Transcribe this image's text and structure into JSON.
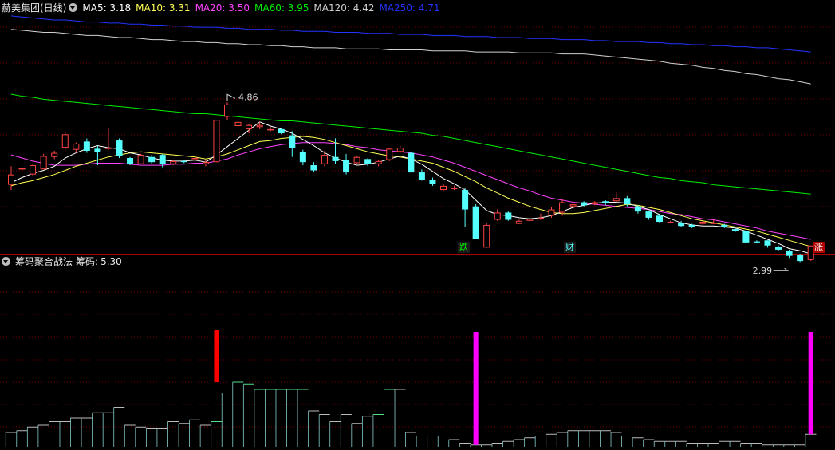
{
  "header": {
    "stock": "赫美集团(日线)",
    "ma": [
      {
        "label": "MA5:",
        "value": "3.18",
        "color": "#ffffff"
      },
      {
        "label": "MA10:",
        "value": "3.31",
        "color": "#ffff55"
      },
      {
        "label": "MA20:",
        "value": "3.50",
        "color": "#ff44ff"
      },
      {
        "label": "MA60:",
        "value": "3.95",
        "color": "#00ee00"
      },
      {
        "label": "MA120:",
        "value": "4.42",
        "color": "#d0d0d0"
      },
      {
        "label": "MA250:",
        "value": "4.71",
        "color": "#2233ff"
      }
    ]
  },
  "indicator": {
    "title": "筹码聚合战法",
    "label": "筹码:",
    "value": "5.30"
  },
  "tags": {
    "high": "4.86",
    "low": "2.99",
    "die": "跌",
    "cai": "财",
    "zhang": "涨"
  },
  "colors": {
    "up": "#ff4444",
    "down": "#54ffff",
    "grid": "#7a0000",
    "divider": "#aa0000",
    "magenta": "#ff00ff",
    "red": "#ff0000"
  },
  "chart_data": {
    "type": "candlestick",
    "price_range": [
      2.9,
      5.1
    ],
    "candles": [
      [
        3.43,
        3.53,
        3.38,
        3.61
      ],
      [
        3.58,
        3.59,
        3.55,
        3.64
      ],
      [
        3.53,
        3.62,
        3.51,
        3.63
      ],
      [
        3.58,
        3.71,
        3.58,
        3.73
      ],
      [
        3.7,
        3.74,
        3.68,
        3.76
      ],
      [
        3.79,
        3.92,
        3.77,
        3.94
      ],
      [
        3.77,
        3.83,
        3.74,
        3.84
      ],
      [
        3.85,
        3.76,
        3.74,
        3.88
      ],
      [
        3.78,
        3.75,
        3.62,
        3.81
      ],
      [
        3.79,
        3.79,
        3.77,
        3.98
      ],
      [
        3.86,
        3.71,
        3.69,
        3.88
      ],
      [
        3.69,
        3.63,
        3.62,
        3.7
      ],
      [
        3.63,
        3.72,
        3.63,
        3.73
      ],
      [
        3.7,
        3.65,
        3.63,
        3.72
      ],
      [
        3.72,
        3.63,
        3.6,
        3.73
      ],
      [
        3.63,
        3.66,
        3.62,
        3.67
      ],
      [
        3.66,
        3.65,
        3.64,
        3.67
      ],
      [
        3.68,
        3.69,
        3.65,
        3.7
      ],
      [
        3.63,
        3.65,
        3.61,
        3.67
      ],
      [
        3.65,
        4.06,
        3.65,
        4.06
      ],
      [
        4.09,
        4.21,
        4.06,
        4.23
      ],
      [
        4.0,
        4.04,
        3.98,
        4.05
      ],
      [
        3.97,
        4.01,
        3.93,
        4.02
      ],
      [
        3.99,
        4.01,
        3.97,
        4.04
      ],
      [
        3.97,
        3.97,
        3.95,
        3.99
      ],
      [
        3.97,
        3.93,
        3.92,
        3.98
      ],
      [
        3.91,
        3.79,
        3.7,
        3.95
      ],
      [
        3.75,
        3.65,
        3.62,
        3.77
      ],
      [
        3.62,
        3.57,
        3.55,
        3.65
      ],
      [
        3.63,
        3.72,
        3.61,
        3.76
      ],
      [
        3.7,
        3.66,
        3.63,
        3.88
      ],
      [
        3.67,
        3.55,
        3.53,
        3.73
      ],
      [
        3.64,
        3.7,
        3.63,
        3.71
      ],
      [
        3.68,
        3.63,
        3.61,
        3.69
      ],
      [
        3.63,
        3.66,
        3.61,
        3.67
      ],
      [
        3.67,
        3.78,
        3.66,
        3.79
      ],
      [
        3.75,
        3.79,
        3.74,
        3.81
      ],
      [
        3.74,
        3.55,
        3.55,
        3.75
      ],
      [
        3.55,
        3.48,
        3.47,
        3.58
      ],
      [
        3.48,
        3.44,
        3.42,
        3.5
      ],
      [
        3.38,
        3.42,
        3.37,
        3.44
      ],
      [
        3.4,
        3.4,
        3.38,
        3.42
      ],
      [
        3.38,
        3.19,
        3.02,
        3.4
      ],
      [
        3.22,
        2.9,
        2.9,
        3.24
      ],
      [
        2.82,
        3.04,
        2.82,
        3.06
      ],
      [
        3.09,
        3.16,
        3.08,
        3.19
      ],
      [
        3.16,
        3.09,
        3.08,
        3.17
      ],
      [
        3.05,
        3.08,
        3.05,
        3.09
      ],
      [
        3.08,
        3.1,
        3.07,
        3.12
      ],
      [
        3.1,
        3.11,
        3.09,
        3.15
      ],
      [
        3.13,
        3.19,
        3.11,
        3.21
      ],
      [
        3.16,
        3.26,
        3.13,
        3.29
      ],
      [
        3.22,
        3.24,
        3.19,
        3.27
      ],
      [
        3.26,
        3.23,
        3.22,
        3.27
      ],
      [
        3.24,
        3.26,
        3.23,
        3.27
      ],
      [
        3.27,
        3.25,
        3.23,
        3.28
      ],
      [
        3.27,
        3.3,
        3.25,
        3.36
      ],
      [
        3.3,
        3.24,
        3.22,
        3.32
      ],
      [
        3.22,
        3.17,
        3.15,
        3.23
      ],
      [
        3.17,
        3.11,
        3.09,
        3.18
      ],
      [
        3.13,
        3.07,
        3.06,
        3.15
      ],
      [
        3.07,
        3.07,
        3.06,
        3.08
      ],
      [
        3.06,
        3.03,
        3.02,
        3.08
      ],
      [
        3.04,
        3.02,
        3.01,
        3.05
      ],
      [
        3.05,
        3.07,
        3.02,
        3.08
      ],
      [
        3.06,
        3.06,
        3.05,
        3.09
      ],
      [
        3.04,
        3.02,
        3.01,
        3.05
      ],
      [
        3.0,
        2.98,
        2.97,
        3.01
      ],
      [
        2.98,
        2.87,
        2.85,
        2.99
      ],
      [
        2.88,
        2.87,
        2.86,
        2.89
      ],
      [
        2.89,
        2.84,
        2.82,
        2.89
      ],
      [
        2.83,
        2.8,
        2.79,
        2.84
      ],
      [
        2.79,
        2.74,
        2.72,
        2.8
      ],
      [
        2.75,
        2.69,
        2.68,
        2.76
      ],
      [
        2.7,
        2.84,
        2.69,
        2.84
      ]
    ],
    "ma5": [
      3.45,
      3.5,
      3.54,
      3.57,
      3.61,
      3.69,
      3.74,
      3.78,
      3.81,
      3.79,
      3.78,
      3.74,
      3.72,
      3.69,
      3.67,
      3.66,
      3.66,
      3.67,
      3.65,
      3.72,
      3.8,
      3.88,
      3.96,
      4.04,
      4.0,
      3.97,
      3.93,
      3.87,
      3.81,
      3.74,
      3.69,
      3.65,
      3.62,
      3.63,
      3.65,
      3.68,
      3.71,
      3.68,
      3.63,
      3.56,
      3.49,
      3.44,
      3.38,
      3.28,
      3.18,
      3.14,
      3.13,
      3.11,
      3.1,
      3.11,
      3.13,
      3.17,
      3.21,
      3.23,
      3.25,
      3.26,
      3.26,
      3.25,
      3.22,
      3.19,
      3.14,
      3.1,
      3.06,
      3.04,
      3.03,
      3.03,
      3.02,
      3.01,
      2.98,
      2.94,
      2.9,
      2.86,
      2.81,
      2.79,
      2.76
    ],
    "ma10": [
      3.42,
      3.45,
      3.47,
      3.5,
      3.53,
      3.57,
      3.61,
      3.64,
      3.67,
      3.7,
      3.72,
      3.74,
      3.75,
      3.74,
      3.73,
      3.72,
      3.71,
      3.7,
      3.68,
      3.7,
      3.73,
      3.77,
      3.81,
      3.85,
      3.86,
      3.88,
      3.89,
      3.9,
      3.89,
      3.87,
      3.84,
      3.81,
      3.78,
      3.75,
      3.73,
      3.71,
      3.7,
      3.68,
      3.66,
      3.64,
      3.6,
      3.56,
      3.51,
      3.46,
      3.4,
      3.35,
      3.3,
      3.26,
      3.22,
      3.19,
      3.16,
      3.15,
      3.15,
      3.16,
      3.18,
      3.2,
      3.22,
      3.24,
      3.23,
      3.21,
      3.19,
      3.16,
      3.13,
      3.1,
      3.08,
      3.06,
      3.04,
      3.02,
      3.0,
      2.98,
      2.95,
      2.92,
      2.89,
      2.86,
      2.83
    ],
    "ma20": [
      3.72,
      3.69,
      3.66,
      3.64,
      3.62,
      3.62,
      3.62,
      3.63,
      3.64,
      3.64,
      3.64,
      3.63,
      3.62,
      3.62,
      3.62,
      3.63,
      3.63,
      3.64,
      3.64,
      3.66,
      3.68,
      3.72,
      3.75,
      3.78,
      3.8,
      3.82,
      3.83,
      3.84,
      3.84,
      3.84,
      3.83,
      3.82,
      3.8,
      3.79,
      3.77,
      3.76,
      3.75,
      3.74,
      3.72,
      3.7,
      3.67,
      3.64,
      3.6,
      3.56,
      3.52,
      3.48,
      3.44,
      3.4,
      3.37,
      3.33,
      3.3,
      3.28,
      3.26,
      3.25,
      3.24,
      3.23,
      3.22,
      3.21,
      3.2,
      3.19,
      3.17,
      3.15,
      3.14,
      3.12,
      3.1,
      3.09,
      3.07,
      3.05,
      3.03,
      3.01,
      2.98,
      2.96,
      2.94,
      2.92,
      2.9
    ],
    "ma60": [
      4.31,
      4.29,
      4.28,
      4.26,
      4.25,
      4.24,
      4.23,
      4.22,
      4.21,
      4.2,
      4.19,
      4.18,
      4.17,
      4.16,
      4.15,
      4.14,
      4.13,
      4.12,
      4.12,
      4.11,
      4.1,
      4.09,
      4.08,
      4.07,
      4.06,
      4.05,
      4.05,
      4.04,
      4.03,
      4.02,
      4.01,
      4.0,
      3.99,
      3.98,
      3.97,
      3.96,
      3.95,
      3.94,
      3.93,
      3.91,
      3.9,
      3.88,
      3.86,
      3.84,
      3.82,
      3.8,
      3.78,
      3.76,
      3.74,
      3.72,
      3.7,
      3.68,
      3.66,
      3.64,
      3.62,
      3.6,
      3.58,
      3.56,
      3.54,
      3.52,
      3.5,
      3.49,
      3.47,
      3.46,
      3.45,
      3.43,
      3.42,
      3.41,
      3.4,
      3.39,
      3.38,
      3.37,
      3.36,
      3.35,
      3.34
    ],
    "ma120": [
      4.94,
      4.93,
      4.92,
      4.91,
      4.91,
      4.9,
      4.89,
      4.88,
      4.88,
      4.87,
      4.86,
      4.86,
      4.85,
      4.84,
      4.84,
      4.83,
      4.82,
      4.82,
      4.81,
      4.81,
      4.8,
      4.8,
      4.79,
      4.79,
      4.78,
      4.78,
      4.77,
      4.77,
      4.76,
      4.76,
      4.76,
      4.75,
      4.75,
      4.75,
      4.75,
      4.74,
      4.74,
      4.74,
      4.74,
      4.73,
      4.73,
      4.73,
      4.73,
      4.72,
      4.72,
      4.72,
      4.72,
      4.71,
      4.71,
      4.71,
      4.71,
      4.7,
      4.7,
      4.7,
      4.69,
      4.68,
      4.67,
      4.66,
      4.65,
      4.64,
      4.63,
      4.61,
      4.6,
      4.59,
      4.57,
      4.56,
      4.54,
      4.53,
      4.51,
      4.5,
      4.48,
      4.46,
      4.45,
      4.43,
      4.41
    ],
    "ma250": [
      5.07,
      5.06,
      5.05,
      5.04,
      5.03,
      5.03,
      5.02,
      5.01,
      5.01,
      5.0,
      5.0,
      4.99,
      4.99,
      4.98,
      4.98,
      4.97,
      4.97,
      4.96,
      4.96,
      4.96,
      4.95,
      4.95,
      4.94,
      4.94,
      4.94,
      4.93,
      4.93,
      4.92,
      4.92,
      4.92,
      4.91,
      4.91,
      4.91,
      4.9,
      4.9,
      4.9,
      4.89,
      4.89,
      4.89,
      4.88,
      4.88,
      4.88,
      4.87,
      4.87,
      4.87,
      4.86,
      4.86,
      4.86,
      4.85,
      4.85,
      4.85,
      4.84,
      4.84,
      4.84,
      4.83,
      4.83,
      4.82,
      4.82,
      4.82,
      4.81,
      4.81,
      4.8,
      4.8,
      4.79,
      4.79,
      4.78,
      4.78,
      4.77,
      4.77,
      4.76,
      4.76,
      4.75,
      4.74,
      4.73,
      4.72
    ],
    "chip_range": [
      0,
      1.0
    ],
    "chips": [
      0.08,
      0.09,
      0.11,
      0.12,
      0.14,
      0.14,
      0.16,
      0.16,
      0.19,
      0.19,
      0.22,
      0.12,
      0.11,
      0.1,
      0.1,
      0.14,
      0.13,
      0.15,
      0.12,
      0.14,
      0.3,
      0.36,
      0.35,
      0.32,
      0.32,
      0.32,
      0.32,
      0.32,
      0.2,
      0.18,
      0.14,
      0.18,
      0.13,
      0.17,
      0.18,
      0.32,
      0.32,
      0.08,
      0.06,
      0.06,
      0.06,
      0.04,
      0.02,
      0.01,
      0.01,
      0.02,
      0.03,
      0.04,
      0.05,
      0.06,
      0.07,
      0.08,
      0.09,
      0.09,
      0.09,
      0.09,
      0.08,
      0.06,
      0.05,
      0.04,
      0.03,
      0.03,
      0.03,
      0.02,
      0.02,
      0.02,
      0.03,
      0.03,
      0.02,
      0.02,
      0.01,
      0.01,
      0.01,
      0.01,
      0.07
    ],
    "chip_tops_green": [
      19,
      20,
      21,
      22,
      23,
      24,
      25,
      26,
      27,
      34,
      35
    ],
    "spikes": [
      {
        "index": 19,
        "from": 0.36,
        "to": 0.65,
        "color": "#ff0000"
      },
      {
        "index": 43,
        "from": 0.01,
        "to": 0.64,
        "color": "#ff00ff"
      },
      {
        "index": 74,
        "from": 0.07,
        "to": 0.64,
        "color": "#ff00ff"
      }
    ],
    "markers": [
      {
        "index": 20,
        "label": "4.86",
        "kind": "high"
      },
      {
        "index": 72,
        "label": "2.99",
        "kind": "low"
      }
    ]
  }
}
